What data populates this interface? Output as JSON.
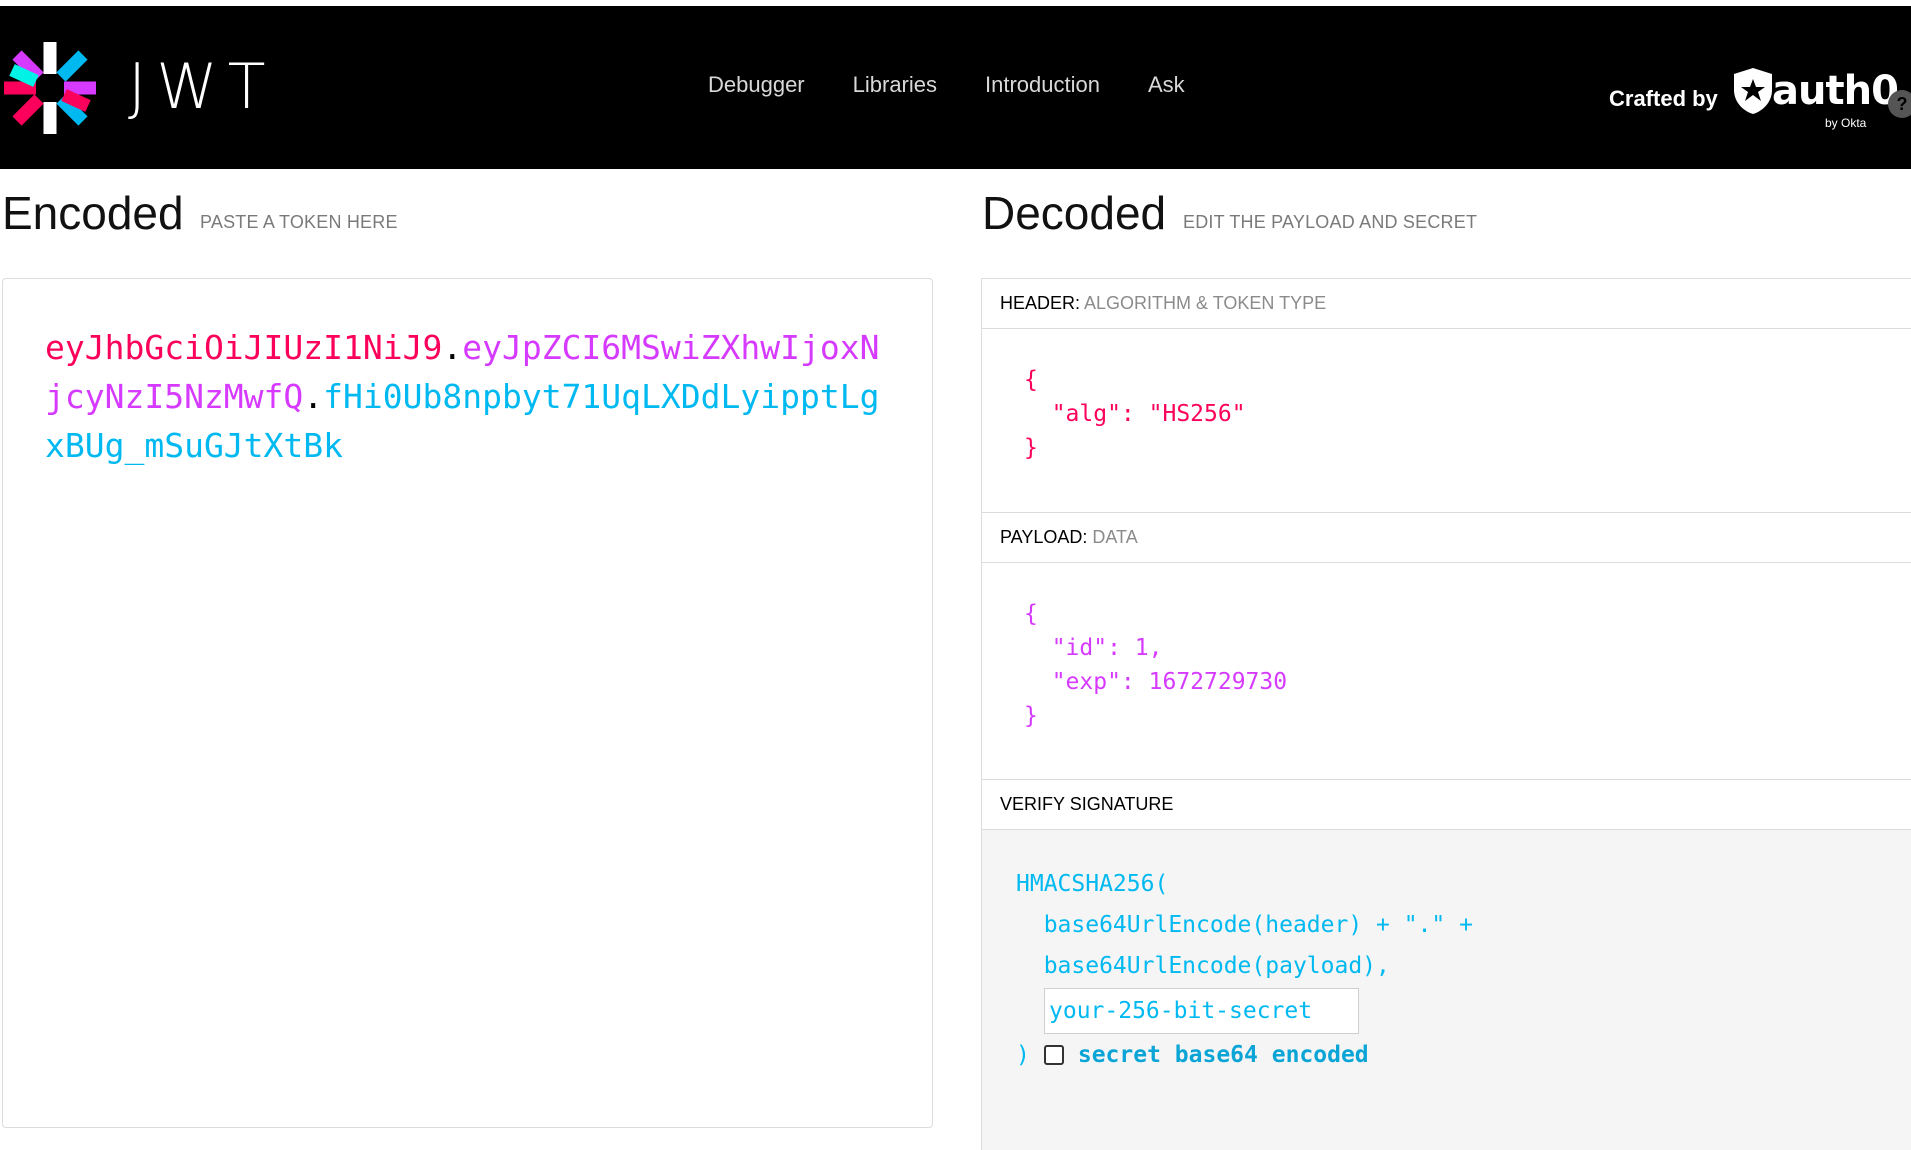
{
  "nav": {
    "logo_text": "JWT",
    "links": [
      "Debugger",
      "Libraries",
      "Introduction",
      "Ask"
    ],
    "crafted_by": "Crafted by",
    "brand": "auth0",
    "brand_sub": "by Okta",
    "help": "?"
  },
  "encoded": {
    "title": "Encoded",
    "subtitle": "PASTE A TOKEN HERE",
    "token_header": "eyJhbGciOiJIUzI1NiJ9",
    "token_payload": "eyJpZCI6MSwiZXhwIjoxNjcyNzI5NzMwfQ",
    "token_signature": "fHi0Ub8npbyt71UqLXDdLyipptLgxBUg_mSuGJtXtBk",
    "dot": "."
  },
  "decoded": {
    "title": "Decoded",
    "subtitle": "EDIT THE PAYLOAD AND SECRET",
    "header_label": "HEADER:",
    "header_sub": "ALGORITHM & TOKEN TYPE",
    "header_json": "{\n  \"alg\": \"HS256\"\n}",
    "payload_label": "PAYLOAD:",
    "payload_sub": "DATA",
    "payload_json": "{\n  \"id\": 1,\n  \"exp\": 1672729730\n}",
    "verify_label": "VERIFY SIGNATURE",
    "verify_lines": [
      "HMACSHA256(",
      "  base64UrlEncode(header) + \".\" +",
      "  base64UrlEncode(payload),"
    ],
    "secret_placeholder": "your-256-bit-secret",
    "close_paren": ")",
    "checkbox_label": "secret base64 encoded"
  },
  "colors": {
    "header": "#fb015b",
    "payload": "#d63aff",
    "signature": "#00b9f1"
  }
}
